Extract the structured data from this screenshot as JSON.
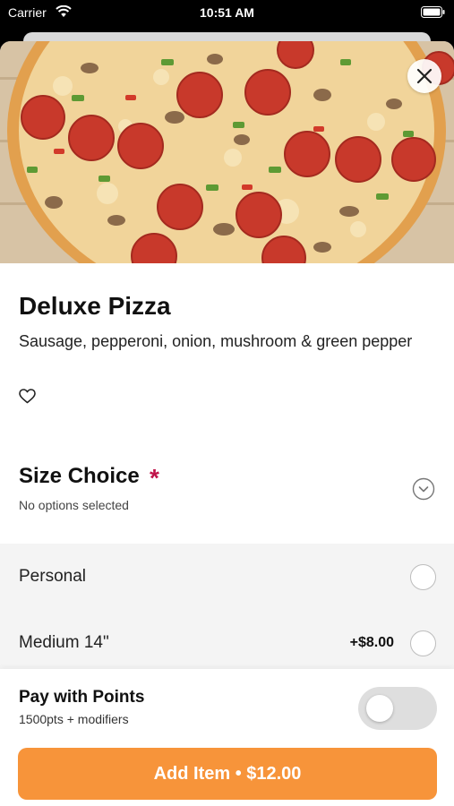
{
  "status_bar": {
    "carrier": "Carrier",
    "time": "10:51 AM"
  },
  "item": {
    "title": "Deluxe Pizza",
    "description": "Sausage, pepperoni, onion, mushroom & green pepper"
  },
  "size_choice": {
    "title": "Size Choice",
    "required_marker": "*",
    "subtitle": "No options selected",
    "options": [
      {
        "label": "Personal",
        "price": ""
      },
      {
        "label": "Medium 14\"",
        "price": "+$8.00"
      }
    ]
  },
  "points": {
    "title": "Pay with Points",
    "subtitle": "1500pts + modifiers",
    "enabled": false
  },
  "add_button": {
    "label": "Add Item • $12.00"
  },
  "colors": {
    "accent": "#f7943a",
    "required": "#c0144a"
  },
  "icons": [
    "wifi-icon",
    "battery-icon",
    "close-icon",
    "heart-icon",
    "chevron-down-circle-icon"
  ]
}
